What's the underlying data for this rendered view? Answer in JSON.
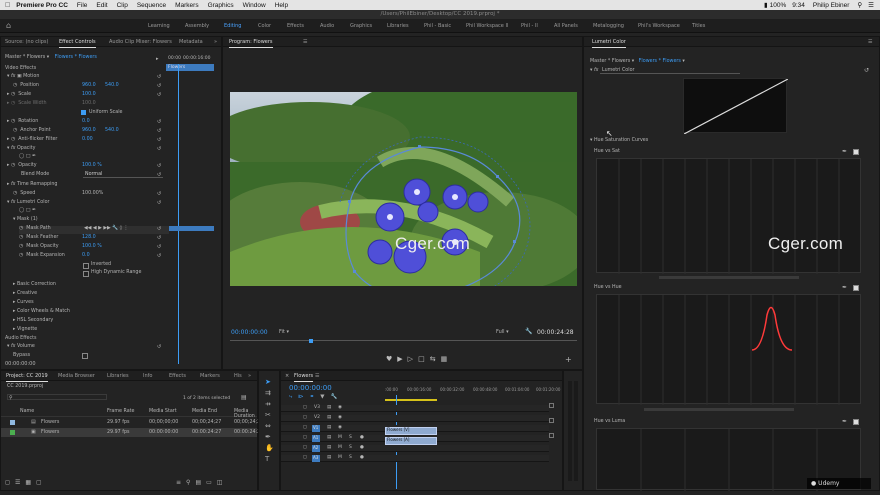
{
  "menubar": {
    "items": [
      "Premiere Pro CC",
      "File",
      "Edit",
      "Clip",
      "Sequence",
      "Markers",
      "Graphics",
      "Window",
      "Help"
    ],
    "status": {
      "battery": "100%",
      "time": "9:34",
      "user": "Philip Ebiner"
    }
  },
  "titlebar": "/Users/PhilEbiner/Desktop/CC 2019.prproj *",
  "workspaces": [
    "Learning",
    "Assembly",
    "Editing",
    "Color",
    "Effects",
    "Audio",
    "Graphics",
    "Libraries",
    "Phil - Basic",
    "Phil Workspace II",
    "Phil - II",
    "All Panels",
    "Metalogging",
    "Phil's Workspace",
    "Titles"
  ],
  "source_panel": {
    "tabs": [
      "Source: (no clips)",
      "Effect Controls",
      "Audio Clip Mixer: Flowers",
      "Metadata"
    ],
    "master": "Master * Flowers",
    "clip": "Flowers * Flowers",
    "timecode_start": "00:00",
    "timecode_end": "00:00:16:00",
    "clip_label": "Flowers",
    "bottom_timecode": "00:00:00:00"
  },
  "effects": {
    "video_effects": "Video Effects",
    "motion": "Motion",
    "position": "Position",
    "pos_x": "960.0",
    "pos_y": "540.0",
    "scale": "Scale",
    "scale_val": "100.0",
    "scale_width": "Scale Width",
    "scale_width_val": "100.0",
    "uniform": "Uniform Scale",
    "rotation": "Rotation",
    "rotation_val": "0.0",
    "anchor": "Anchor Point",
    "anchor_x": "960.0",
    "anchor_y": "540.0",
    "flicker": "Anti-flicker Filter",
    "flicker_val": "0.00",
    "opacity": "Opacity",
    "opacity_prop": "Opacity",
    "opacity_val": "100.0 %",
    "blend": "Blend Mode",
    "blend_val": "Normal",
    "time_remap": "Time Remapping",
    "speed": "Speed",
    "speed_val": "100.00%",
    "lumetri": "Lumetri Color",
    "mask": "Mask (1)",
    "mask_path": "Mask Path",
    "mask_feather": "Mask Feather",
    "mask_feather_val": "128.0",
    "mask_opacity": "Mask Opacity",
    "mask_opacity_val": "100.0 %",
    "mask_expansion": "Mask Expansion",
    "mask_expansion_val": "0.0",
    "inverted": "Inverted",
    "hdr": "High Dynamic Range",
    "sections": [
      "Basic Correction",
      "Creative",
      "Curves",
      "Color Wheels & Match",
      "HSL Secondary",
      "Vignette"
    ],
    "audio_effects": "Audio Effects",
    "volume": "Volume",
    "bypass": "Bypass"
  },
  "program": {
    "title": "Program: Flowers",
    "timecode": "00:00:00:00",
    "fit": "Fit",
    "quality": "Full",
    "duration": "00:00:24:28"
  },
  "project": {
    "tabs": [
      "Project: CC 2019",
      "Media Browser",
      "Libraries",
      "Info",
      "Effects",
      "Markers",
      "His"
    ],
    "filename": "CC 2019.prproj",
    "selection": "1 of 2 items selected",
    "columns": [
      "Name",
      "Frame Rate",
      "Media Start",
      "Media End",
      "Media Duration"
    ],
    "rows": [
      {
        "name": "Flowers",
        "fps": "29.97 fps",
        "start": "00;00;00;00",
        "end": "00;00;24;27",
        "dur": "00;00;24;28"
      },
      {
        "name": "Flowers",
        "fps": "29.97 fps",
        "start": "00:00:00:00",
        "end": "00:00:24:27",
        "dur": "00:00:24:28"
      }
    ]
  },
  "timeline": {
    "tab": "Flowers",
    "timecode": "00:00:00:00",
    "ruler": [
      ":00:00",
      "00:00:16:00",
      "00:00:32:00",
      "00:00:48:00",
      "00:01:04:00",
      "00:01:20:00"
    ],
    "video_tracks": [
      "V3",
      "V2",
      "V1"
    ],
    "audio_tracks": [
      "A1",
      "A2",
      "A3"
    ],
    "clip_v": "Flowers [V]",
    "clip_a": "Flowers [A]"
  },
  "lumetri": {
    "tab": "Lumetri Color",
    "master": "Master * Flowers",
    "clip": "Flowers * Flowers",
    "effect": "Lumetri Color",
    "hsc": "Hue Saturation Curves",
    "hue_vs_sat": "Hue vs Sat",
    "hue_vs_hue": "Hue vs Hue",
    "hue_vs_luma": "Hue vs Luma"
  },
  "watermark": "Cger.com",
  "udemy": "Udemy",
  "colors": {
    "accent": "#3d9df5",
    "panel": "#232323",
    "dark": "#1a1a1a"
  }
}
